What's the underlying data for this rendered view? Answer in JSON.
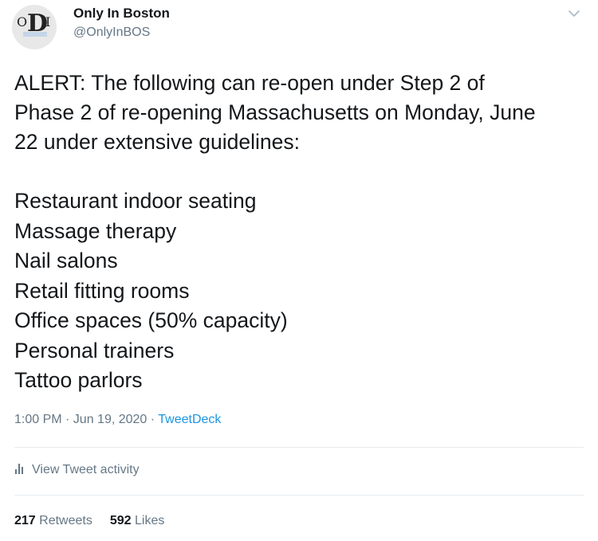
{
  "author": {
    "name": "Only In Boston",
    "handle": "@OnlyInBOS",
    "avatar_monogram": [
      "O",
      "D",
      "I"
    ]
  },
  "tweet": {
    "intro": "ALERT: The following can re-open under Step 2 of\nPhase 2 of re-opening Massachusetts on Monday, June\n22 under extensive guidelines:",
    "items": [
      "Restaurant indoor seating",
      "Massage therapy",
      "Nail salons",
      "Retail fitting rooms",
      "Office spaces (50% capacity)",
      "Personal trainers",
      "Tattoo parlors"
    ]
  },
  "meta": {
    "time_date": "1:00 PM · Jun 19, 2020 · ",
    "source": "TweetDeck"
  },
  "activity": {
    "label": "View Tweet activity"
  },
  "stats": {
    "retweets_count": "217",
    "retweets_label": "Retweets",
    "likes_count": "592",
    "likes_label": "Likes"
  },
  "colors": {
    "text": "#14171a",
    "secondary": "#657786",
    "link": "#1b95e0",
    "divider": "#e6ecf0"
  },
  "icons": {
    "menu": "chevron-down-icon",
    "activity": "bar-chart-icon"
  }
}
